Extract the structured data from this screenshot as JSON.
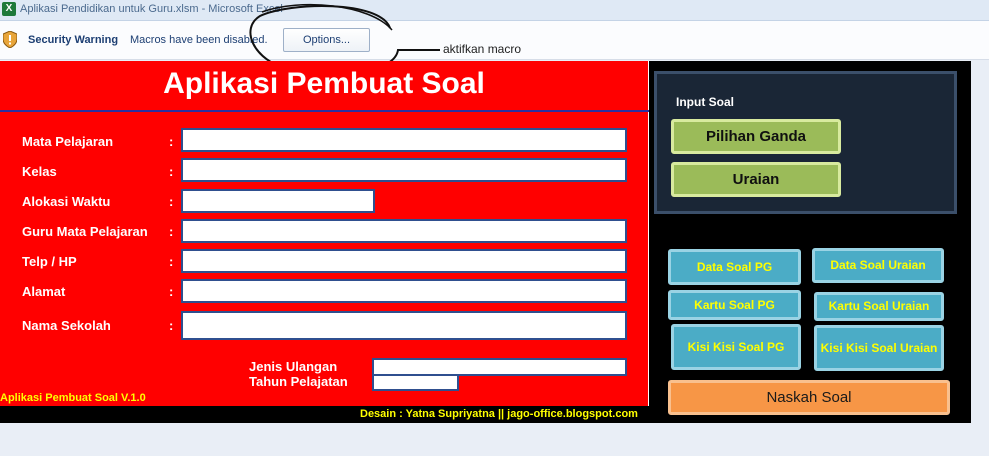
{
  "window": {
    "app_icon": "excel-icon",
    "title": "Aplikasi Pendidikan untuk Guru.xlsm - Microsoft Excel"
  },
  "security_bar": {
    "icon": "shield-warning-icon",
    "title": "Security Warning",
    "message": "Macros have been disabled.",
    "options_label": "Options..."
  },
  "annotation": {
    "note": "aktifkan macro"
  },
  "form": {
    "heading": "Aplikasi Pembuat Soal",
    "fields": [
      {
        "label": "Mata Pelajaran",
        "colon": ":",
        "value": ""
      },
      {
        "label": "Kelas",
        "colon": ":",
        "value": ""
      },
      {
        "label": "Alokasi Waktu",
        "colon": ":",
        "value": ""
      },
      {
        "label": "Guru Mata Pelajaran",
        "colon": ":",
        "value": ""
      },
      {
        "label": "Telp / HP",
        "colon": ":",
        "value": ""
      },
      {
        "label": "Alamat",
        "colon": ":",
        "value": ""
      },
      {
        "label": "Nama Sekolah",
        "colon": ":",
        "value": ""
      }
    ],
    "jenis_ulangan": {
      "label": "Jenis Ulangan",
      "value": ""
    },
    "tahun_pelajaran": {
      "label": "Tahun Pelajatan",
      "value": ""
    },
    "version": "Aplikasi Pembuat Soal V.1.0",
    "credit": "Desain : Yatna Supriyatna || jago-office.blogspot.com"
  },
  "side": {
    "input_title": "Input Soal",
    "pilihan_ganda": "Pilihan Ganda",
    "uraian": "Uraian",
    "data_soal_pg": "Data Soal PG",
    "data_soal_uraian": "Data Soal Uraian",
    "kartu_soal_pg": "Kartu Soal PG",
    "kartu_soal_uraian": "Kartu Soal Uraian",
    "kisi_pg": "Kisi Kisi  Soal PG",
    "kisi_uraian": "Kisi Kisi  Soal Uraian",
    "naskah_soal": "Naskah Soal"
  },
  "colors": {
    "form_bg": "#ff0000",
    "green_button": "#9bbb59",
    "cyan_button": "#4bacc6",
    "orange_button": "#f79646",
    "accent_text": "#ffff00"
  }
}
